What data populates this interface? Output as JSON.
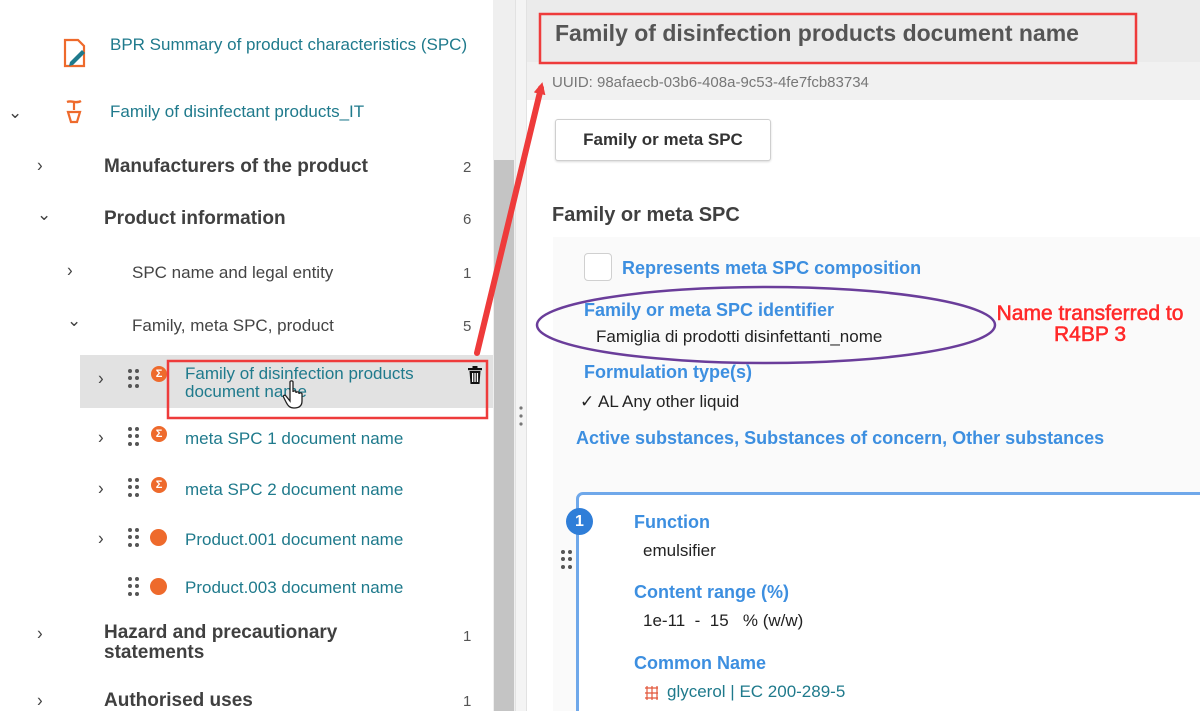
{
  "tree": {
    "spc_doc_label": "BPR Summary of product characteristics (SPC)",
    "family_root_label": "Family of disinfectant products_IT",
    "items": {
      "manufacturers": {
        "label": "Manufacturers of the product",
        "count": "2"
      },
      "product_information": {
        "label": "Product information",
        "count": "6"
      },
      "spc_name": {
        "label": "SPC name and legal entity",
        "count": "1"
      },
      "family_meta": {
        "label": "Family, meta SPC, product",
        "count": "5"
      },
      "hazard": {
        "label": "Hazard and precautionary statements",
        "count": "1"
      },
      "authorised_uses": {
        "label": "Authorised uses",
        "count": "1"
      }
    },
    "documents": [
      {
        "label": "Family of disinfection products document name",
        "icon": "sigma-icon",
        "selected": true
      },
      {
        "label": "meta SPC 1 document name",
        "icon": "sigma-icon"
      },
      {
        "label": "meta SPC 2 document name",
        "icon": "sigma-icon"
      },
      {
        "label": "Product.001 document name",
        "icon": "dot-icon"
      },
      {
        "label": "Product.003 document name",
        "icon": "dot-icon"
      }
    ]
  },
  "detail": {
    "title": "Family of disinfection products document name",
    "uuid": "UUID: 98afaecb-03b6-408a-9c53-4fe7fcb83734",
    "tab_button": "Family or meta SPC",
    "section_title": "Family or meta SPC",
    "fields": {
      "represents_meta": "Represents meta SPC composition",
      "identifier_label": "Family or meta SPC identifier",
      "identifier_value": "Famiglia di prodotti disinfettanti_nome",
      "formulation_label": "Formulation type(s)",
      "formulation_value": "✓ AL Any other liquid",
      "substances_label": "Active substances, Substances of concern, Other substances"
    },
    "substance_card": {
      "number": "1",
      "function_label": "Function",
      "function_value": "emulsifier",
      "content_label": "Content range (%)",
      "content_value": "1e-11  -  15   % (w/w)",
      "common_name_label": "Common Name",
      "common_name_value": "glycerol | EC 200-289-5"
    }
  },
  "annotation": {
    "text": "Name transferred to R4BP 3",
    "color": "#ff2a2a",
    "ellipse_color": "#6a3d9a"
  },
  "colors": {
    "accent_blue": "#3d8fe0",
    "tree_link": "#1f7a8c",
    "orange": "#ee6a2c"
  }
}
